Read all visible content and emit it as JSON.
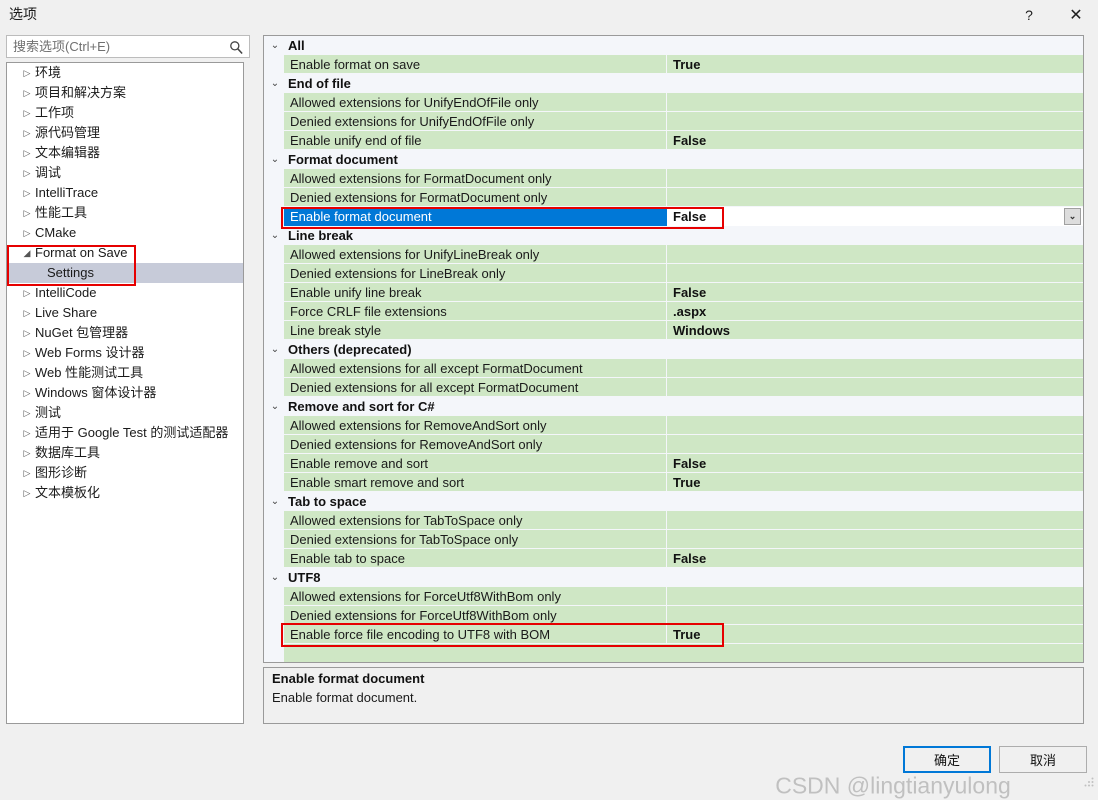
{
  "window": {
    "title": "选项",
    "help_label": "?",
    "close_label": "✕"
  },
  "search": {
    "placeholder": "搜索选项(Ctrl+E)",
    "value": "搜索选项(Ctrl+E)",
    "icon": "search-icon"
  },
  "sidebar": {
    "items": [
      {
        "label": "环境",
        "twisty": "▷",
        "level": 0,
        "selected": false
      },
      {
        "label": "项目和解决方案",
        "twisty": "▷",
        "level": 0,
        "selected": false
      },
      {
        "label": "工作项",
        "twisty": "▷",
        "level": 0,
        "selected": false
      },
      {
        "label": "源代码管理",
        "twisty": "▷",
        "level": 0,
        "selected": false
      },
      {
        "label": "文本编辑器",
        "twisty": "▷",
        "level": 0,
        "selected": false
      },
      {
        "label": "调试",
        "twisty": "▷",
        "level": 0,
        "selected": false
      },
      {
        "label": "IntelliTrace",
        "twisty": "▷",
        "level": 0,
        "selected": false
      },
      {
        "label": "性能工具",
        "twisty": "▷",
        "level": 0,
        "selected": false
      },
      {
        "label": "CMake",
        "twisty": "▷",
        "level": 0,
        "selected": false
      },
      {
        "label": "Format on Save",
        "twisty": "◢",
        "level": 0,
        "selected": false
      },
      {
        "label": "Settings",
        "twisty": "",
        "level": 1,
        "selected": true
      },
      {
        "label": "IntelliCode",
        "twisty": "▷",
        "level": 0,
        "selected": false
      },
      {
        "label": "Live Share",
        "twisty": "▷",
        "level": 0,
        "selected": false
      },
      {
        "label": "NuGet 包管理器",
        "twisty": "▷",
        "level": 0,
        "selected": false
      },
      {
        "label": "Web Forms 设计器",
        "twisty": "▷",
        "level": 0,
        "selected": false
      },
      {
        "label": "Web 性能测试工具",
        "twisty": "▷",
        "level": 0,
        "selected": false
      },
      {
        "label": "Windows 窗体设计器",
        "twisty": "▷",
        "level": 0,
        "selected": false
      },
      {
        "label": "测试",
        "twisty": "▷",
        "level": 0,
        "selected": false
      },
      {
        "label": "适用于 Google Test 的测试适配器",
        "twisty": "▷",
        "level": 0,
        "selected": false
      },
      {
        "label": "数据库工具",
        "twisty": "▷",
        "level": 0,
        "selected": false
      },
      {
        "label": "图形诊断",
        "twisty": "▷",
        "level": 0,
        "selected": false
      },
      {
        "label": "文本模板化",
        "twisty": "▷",
        "level": 0,
        "selected": false
      }
    ]
  },
  "grid": {
    "collapse_glyph": "⌄",
    "dropdown_glyph": "⌄",
    "rows": [
      {
        "kind": "category",
        "label": "All"
      },
      {
        "kind": "property",
        "name": "Enable format on save",
        "value": "True"
      },
      {
        "kind": "category",
        "label": "End of file"
      },
      {
        "kind": "property",
        "name": "Allowed extensions for UnifyEndOfFile only",
        "value": ""
      },
      {
        "kind": "property",
        "name": "Denied extensions for UnifyEndOfFile only",
        "value": ""
      },
      {
        "kind": "property",
        "name": "Enable unify end of file",
        "value": "False"
      },
      {
        "kind": "category",
        "label": "Format document"
      },
      {
        "kind": "property",
        "name": "Allowed extensions for FormatDocument only",
        "value": ""
      },
      {
        "kind": "property",
        "name": "Denied extensions for FormatDocument only",
        "value": ""
      },
      {
        "kind": "property",
        "name": "Enable format document",
        "value": "False",
        "selected": true
      },
      {
        "kind": "category",
        "label": "Line break"
      },
      {
        "kind": "property",
        "name": "Allowed extensions for UnifyLineBreak only",
        "value": ""
      },
      {
        "kind": "property",
        "name": "Denied extensions for LineBreak only",
        "value": ""
      },
      {
        "kind": "property",
        "name": "Enable unify line break",
        "value": "False"
      },
      {
        "kind": "property",
        "name": "Force CRLF file extensions",
        "value": ".aspx"
      },
      {
        "kind": "property",
        "name": "Line break style",
        "value": "Windows"
      },
      {
        "kind": "category",
        "label": "Others (deprecated)"
      },
      {
        "kind": "property",
        "name": "Allowed extensions for all except FormatDocument",
        "value": ""
      },
      {
        "kind": "property",
        "name": "Denied extensions for all except FormatDocument",
        "value": ""
      },
      {
        "kind": "category",
        "label": "Remove and sort for C#"
      },
      {
        "kind": "property",
        "name": "Allowed extensions for RemoveAndSort only",
        "value": ""
      },
      {
        "kind": "property",
        "name": "Denied extensions for RemoveAndSort only",
        "value": ""
      },
      {
        "kind": "property",
        "name": "Enable remove and sort",
        "value": "False"
      },
      {
        "kind": "property",
        "name": "Enable smart remove and sort",
        "value": "True"
      },
      {
        "kind": "category",
        "label": "Tab to space"
      },
      {
        "kind": "property",
        "name": "Allowed extensions for TabToSpace only",
        "value": ""
      },
      {
        "kind": "property",
        "name": "Denied extensions for TabToSpace only",
        "value": ""
      },
      {
        "kind": "property",
        "name": "Enable tab to space",
        "value": "False"
      },
      {
        "kind": "category",
        "label": "UTF8"
      },
      {
        "kind": "property",
        "name": "Allowed extensions for ForceUtf8WithBom only",
        "value": ""
      },
      {
        "kind": "property",
        "name": "Denied extensions for ForceUtf8WithBom only",
        "value": ""
      },
      {
        "kind": "property",
        "name": "Enable force file encoding to UTF8 with BOM",
        "value": "True"
      },
      {
        "kind": "filler"
      }
    ]
  },
  "description": {
    "title": "Enable format document",
    "body": "Enable format document."
  },
  "footer": {
    "ok_label": "确定",
    "cancel_label": "取消"
  },
  "watermark": {
    "text": "CSDN @lingtianyulong"
  },
  "colors": {
    "selection_blue": "#0078d7",
    "property_green": "#cfe7c5",
    "category_bg": "#f4f6fa",
    "annotation_red": "#e60000",
    "tree_selection": "#c7cbd9"
  }
}
